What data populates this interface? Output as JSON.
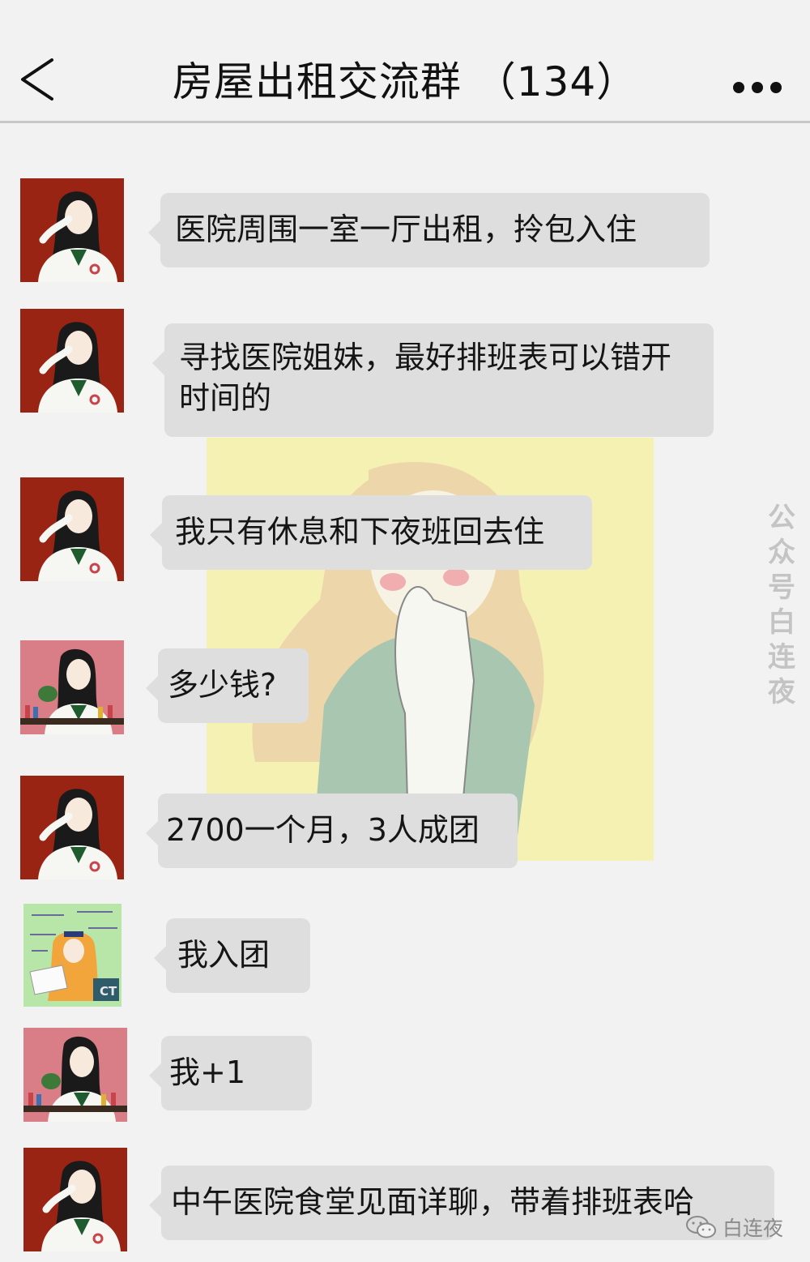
{
  "header": {
    "title": "房屋出租交流群 （134）"
  },
  "messages": [
    {
      "avatar": "doctor-red-avatar",
      "text": "医院周围一室一厅出租，拎包入住"
    },
    {
      "avatar": "doctor-red-avatar",
      "text": "寻找医院姐妹，最好排班表可以错开时间的"
    },
    {
      "avatar": "doctor-red-avatar",
      "text": "我只有休息和下夜班回去住"
    },
    {
      "avatar": "lab-pink-avatar",
      "text": "多少钱?"
    },
    {
      "avatar": "doctor-red-avatar",
      "text": "2700一个月，3人成团"
    },
    {
      "avatar": "green-study-avatar",
      "text": "我入团"
    },
    {
      "avatar": "lab-pink-avatar",
      "text": "我+1"
    },
    {
      "avatar": "doctor-red-avatar",
      "text": "中午医院食堂见面详聊，带着排班表哈"
    }
  ],
  "watermark": {
    "side": "公众号白连夜",
    "bottom": "白连夜"
  },
  "colors": {
    "background": "#f2f2f2",
    "bubble": "#dedede",
    "doctor_avatar_bg": "#9a2414",
    "lab_avatar_bg": "#d97d86",
    "study_avatar_bg": "#b7e6a8",
    "illustration_bg": "#f4f1b3"
  }
}
